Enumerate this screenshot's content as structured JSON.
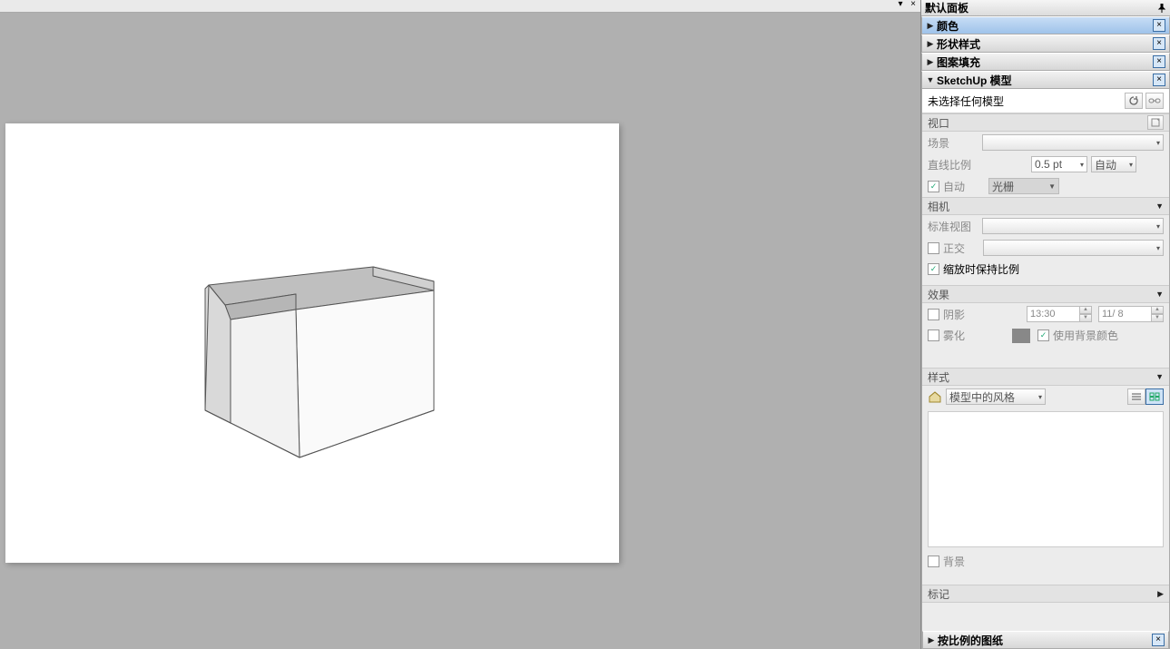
{
  "topstrip": {
    "dropdown_glyph": "▾",
    "close_glyph": "×"
  },
  "panel": {
    "title": "默认面板",
    "sections": {
      "color": {
        "label": "颜色"
      },
      "shape": {
        "label": "形状样式"
      },
      "pattern": {
        "label": "图案填充"
      },
      "model": {
        "label": "SketchUp 模型"
      },
      "scaled": {
        "label": "按比例的图纸"
      }
    }
  },
  "model": {
    "none_selected": "未选择任何模型",
    "viewport_header": "视口",
    "scene_label": "场景",
    "line_scale_label": "直线比例",
    "line_scale_value": "0.5 pt",
    "auto_btn_label": "自动",
    "auto_check_label": "自动",
    "render_mode": "光栅",
    "camera_header": "相机",
    "std_view_label": "标准视图",
    "ortho_label": "正交",
    "preserve_scale_label": "缩放时保持比例",
    "effects_header": "效果",
    "shadow_label": "阴影",
    "shadow_time": "13:30",
    "shadow_date": "11/ 8",
    "fog_label": "雾化",
    "use_bg_color_label": "使用背景颜色",
    "style_header": "样式",
    "style_name": "模型中的风格",
    "background_label": "背景",
    "tag_header": "标记"
  }
}
